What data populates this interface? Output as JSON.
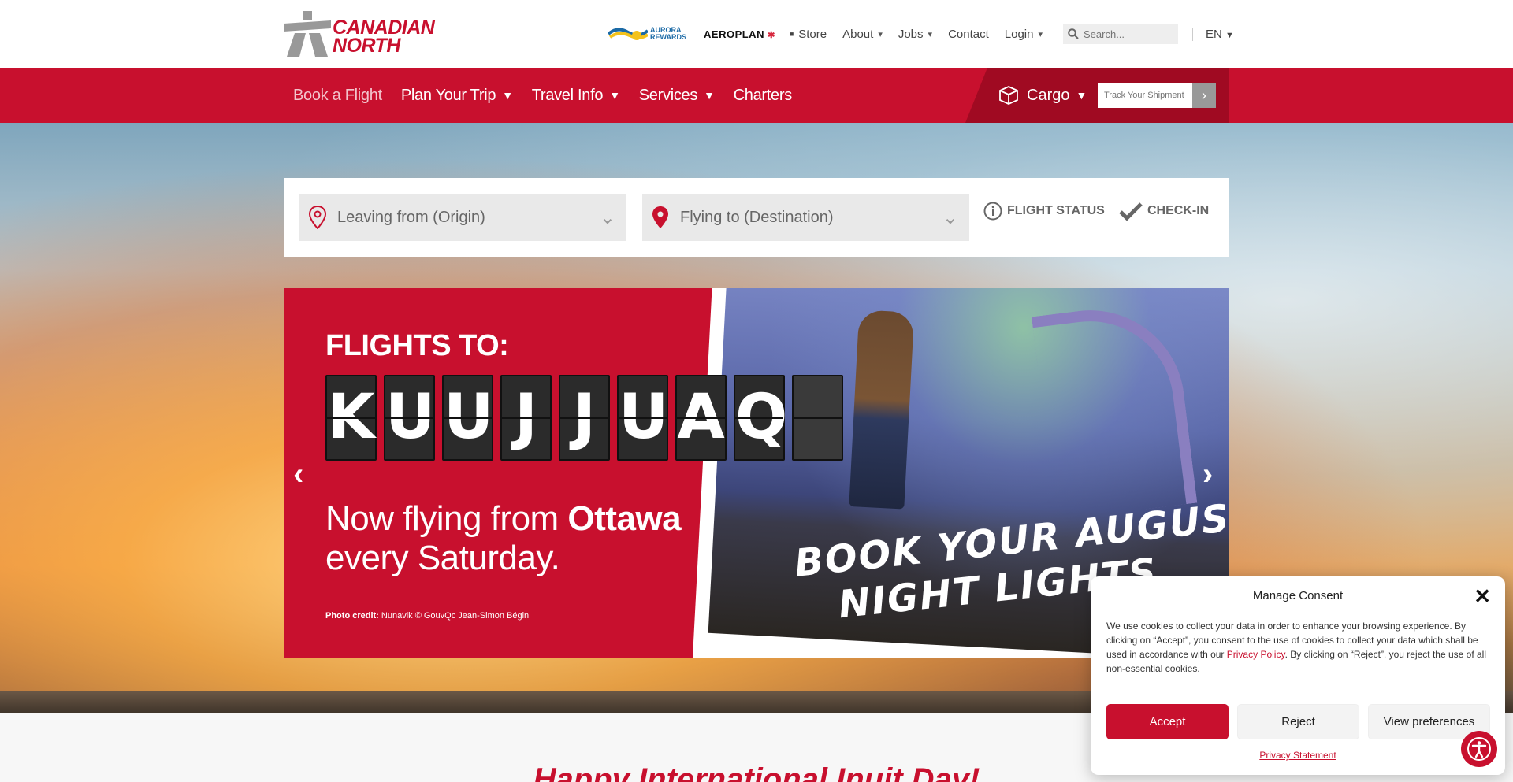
{
  "header": {
    "logo": {
      "line1": "CANADIAN",
      "line2": "NORTH"
    },
    "util_nav": {
      "aurora": {
        "line1": "AURORA",
        "line2": "REWARDS"
      },
      "aeroplan": "AEROPLAN",
      "store": "Store",
      "about": "About",
      "jobs": "Jobs",
      "contact": "Contact",
      "login": "Login",
      "search_placeholder": "Search...",
      "language": "EN"
    }
  },
  "main_nav": {
    "items": [
      {
        "label": "Book a Flight"
      },
      {
        "label": "Plan Your Trip"
      },
      {
        "label": "Travel Info"
      },
      {
        "label": "Services"
      },
      {
        "label": "Charters"
      }
    ],
    "cargo": {
      "label": "Cargo",
      "track_placeholder": "Track Your Shipment"
    }
  },
  "booking": {
    "origin_placeholder": "Leaving from (Origin)",
    "destination_placeholder": "Flying to (Destination)",
    "flight_status": "FLIGHT STATUS",
    "check_in": "CHECK-IN"
  },
  "slide": {
    "flights_to": "FLIGHTS TO:",
    "board": [
      "K",
      "U",
      "U",
      "J",
      "J",
      "U",
      "A",
      "Q",
      ""
    ],
    "text_prefix": "Now flying from ",
    "text_bold": "Ottawa",
    "text_line2": "every Saturday.",
    "credit_label": "Photo credit:",
    "credit_value": "Nunavik © GouvQc Jean-Simon Bégin",
    "cta_line1": "BOOK YOUR AUGUST",
    "cta_line2": "NIGHT LIGHTS"
  },
  "section_heading": "Happy International Inuit Day!",
  "consent": {
    "title": "Manage Consent",
    "body_part1": "We use cookies to collect your data in order to enhance your browsing experience. By clicking on “Accept”, you consent to the use of cookies to collect your data which shall be used in accordance with our ",
    "body_link": "Privacy Policy",
    "body_part2": ". By clicking on “Reject”, you reject the use of all non-essential cookies.",
    "accept": "Accept",
    "reject": "Reject",
    "view_preferences": "View preferences",
    "privacy_statement": "Privacy Statement"
  },
  "colors": {
    "brand_red": "#c8102e",
    "dark_red": "#a00a22"
  }
}
